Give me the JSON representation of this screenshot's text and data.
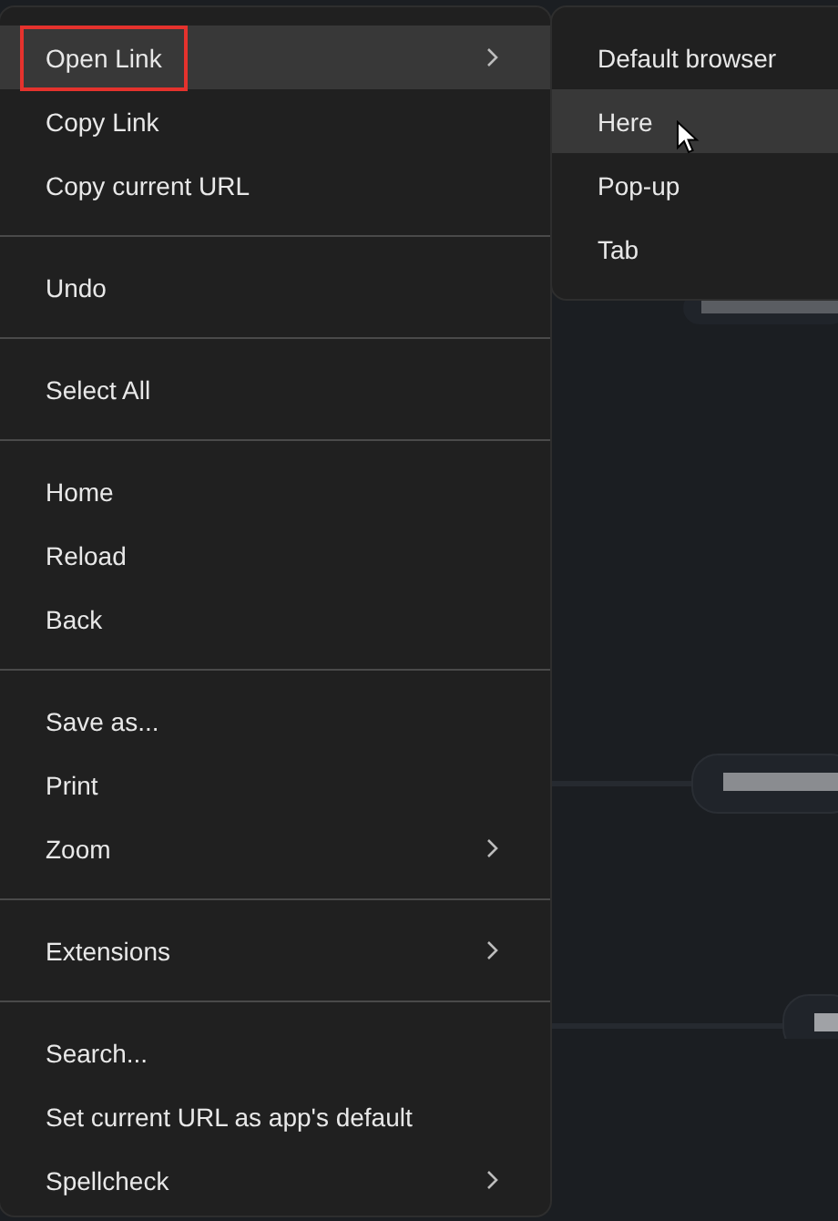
{
  "menu": {
    "items": [
      {
        "kind": "item",
        "label": "Open Link",
        "selected": true,
        "submenu": true,
        "annotated": true
      },
      {
        "kind": "item",
        "label": "Copy Link",
        "selected": false,
        "submenu": false,
        "annotated": false
      },
      {
        "kind": "item",
        "label": "Copy current URL",
        "selected": false,
        "submenu": false,
        "annotated": false
      },
      {
        "kind": "separator"
      },
      {
        "kind": "item",
        "label": "Undo",
        "selected": false,
        "submenu": false,
        "annotated": false
      },
      {
        "kind": "separator"
      },
      {
        "kind": "item",
        "label": "Select All",
        "selected": false,
        "submenu": false,
        "annotated": false
      },
      {
        "kind": "separator"
      },
      {
        "kind": "item",
        "label": "Home",
        "selected": false,
        "submenu": false,
        "annotated": false
      },
      {
        "kind": "item",
        "label": "Reload",
        "selected": false,
        "submenu": false,
        "annotated": false
      },
      {
        "kind": "item",
        "label": "Back",
        "selected": false,
        "submenu": false,
        "annotated": false
      },
      {
        "kind": "separator"
      },
      {
        "kind": "item",
        "label": "Save as...",
        "selected": false,
        "submenu": false,
        "annotated": false
      },
      {
        "kind": "item",
        "label": "Print",
        "selected": false,
        "submenu": false,
        "annotated": false
      },
      {
        "kind": "item",
        "label": "Zoom",
        "selected": false,
        "submenu": true,
        "annotated": false
      },
      {
        "kind": "separator"
      },
      {
        "kind": "item",
        "label": "Extensions",
        "selected": false,
        "submenu": true,
        "annotated": false
      },
      {
        "kind": "separator"
      },
      {
        "kind": "item",
        "label": "Search...",
        "selected": false,
        "submenu": false,
        "annotated": false
      },
      {
        "kind": "item",
        "label": "Set current URL as app's default",
        "selected": false,
        "submenu": false,
        "annotated": false
      },
      {
        "kind": "item",
        "label": "Spellcheck",
        "selected": false,
        "submenu": true,
        "annotated": false
      }
    ]
  },
  "submenu": {
    "items": [
      {
        "label": "Default browser",
        "selected": false,
        "pointer": false
      },
      {
        "label": "Here",
        "selected": true,
        "pointer": true
      },
      {
        "label": "Pop-up",
        "selected": false,
        "pointer": false
      },
      {
        "label": "Tab",
        "selected": false,
        "pointer": false
      }
    ]
  }
}
